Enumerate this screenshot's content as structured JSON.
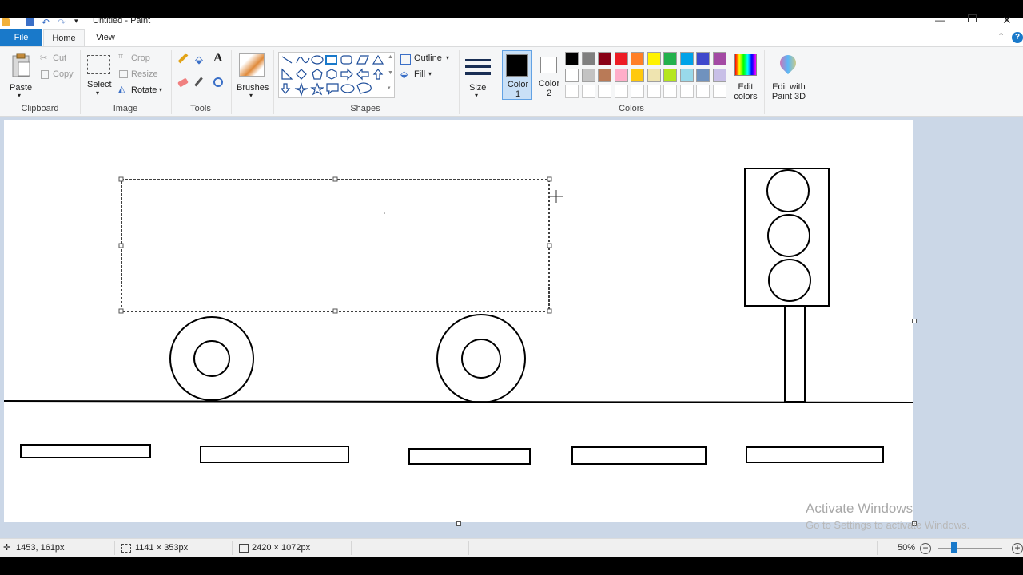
{
  "window": {
    "title": "Untitled - Paint"
  },
  "tabs": {
    "file": "File",
    "home": "Home",
    "view": "View"
  },
  "clipboard": {
    "paste": "Paste",
    "cut": "Cut",
    "copy": "Copy",
    "group": "Clipboard"
  },
  "image": {
    "select": "Select",
    "crop": "Crop",
    "resize": "Resize",
    "rotate": "Rotate",
    "group": "Image"
  },
  "tools": {
    "group": "Tools"
  },
  "brushes": {
    "label": "Brushes"
  },
  "shapes": {
    "group": "Shapes",
    "outline": "Outline",
    "fill": "Fill"
  },
  "size": {
    "label": "Size"
  },
  "colors": {
    "color1": "Color 1",
    "color2": "Color 2",
    "edit_colors": "Edit colors",
    "edit_paint3d": "Edit with Paint 3D",
    "group": "Colors",
    "color1_value": "#000000",
    "color2_value": "#ffffff",
    "palette_row1": [
      "#000000",
      "#7f7f7f",
      "#880015",
      "#ed1c24",
      "#ff7f27",
      "#fff200",
      "#22b14c",
      "#00a2e8",
      "#3f48cc",
      "#a349a4"
    ],
    "palette_row2": [
      "#ffffff",
      "#c3c3c3",
      "#b97a57",
      "#ffaec9",
      "#ffc90e",
      "#efe4b0",
      "#b5e61d",
      "#99d9ea",
      "#7092be",
      "#c8bfe7"
    ],
    "palette_row3": [
      "#ffffff",
      "#ffffff",
      "#ffffff",
      "#ffffff",
      "#ffffff",
      "#ffffff",
      "#ffffff",
      "#ffffff",
      "#ffffff",
      "#ffffff"
    ]
  },
  "status": {
    "cursor_pos": "1453, 161px",
    "selection_size": "1141 × 353px",
    "image_size": "2420 × 1072px",
    "zoom": "50%"
  },
  "watermark": {
    "title": "Activate Windows",
    "subtitle": "Go to Settings to activate Windows."
  }
}
